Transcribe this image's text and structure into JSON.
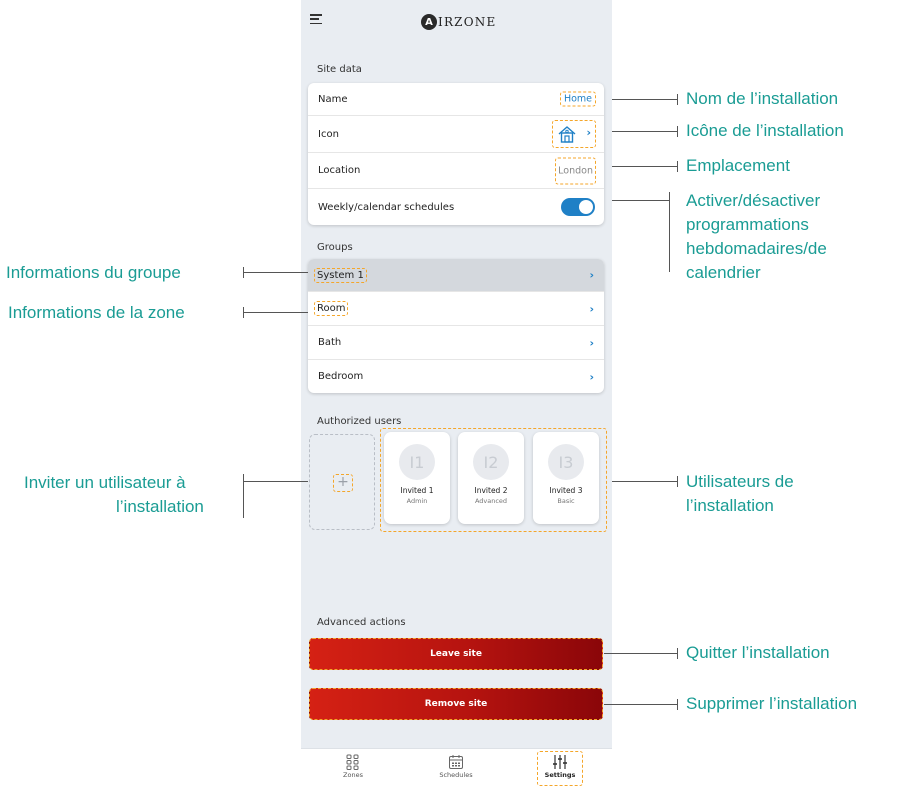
{
  "app": {
    "logo_mark": "A",
    "logo_text": "IRZONE"
  },
  "site_data": {
    "title": "Site data",
    "rows": [
      {
        "label": "Name",
        "value": "Home"
      },
      {
        "label": "Icon"
      },
      {
        "label": "Location",
        "value": "London"
      },
      {
        "label": "Weekly/calendar schedules",
        "toggle": true
      }
    ]
  },
  "groups": {
    "title": "Groups",
    "items": [
      "System 1",
      "Room",
      "Bath",
      "Bedroom"
    ]
  },
  "users": {
    "title": "Authorized users",
    "add_icon": "plus-icon",
    "list": [
      {
        "initials": "I1",
        "name": "Invited 1",
        "role": "Admin"
      },
      {
        "initials": "I2",
        "name": "Invited 2",
        "role": "Advanced"
      },
      {
        "initials": "I3",
        "name": "Invited 3",
        "role": "Basic"
      }
    ]
  },
  "advanced": {
    "title": "Advanced actions",
    "leave_label": "Leave site",
    "remove_label": "Remove site"
  },
  "bottom_nav": [
    "Zones",
    "Schedules",
    "Settings"
  ],
  "annotations": {
    "nom": "Nom de l’installation",
    "icone": "Icône de l’installation",
    "emplacement": "Emplacement",
    "activer": [
      "Activer/désactiver",
      "programmations",
      "hebdomadaires/de",
      "calendrier"
    ],
    "groupe": "Informations du groupe",
    "zone": "Informations de la zone",
    "inviter": [
      "Inviter un utilisateur à",
      "l’installation"
    ],
    "utilisateurs": [
      "Utilisateurs de",
      "l’installation"
    ],
    "quitter": "Quitter l’installation",
    "supprimer": "Supprimer l’installation"
  },
  "colors": {
    "accent": "#1f80c6",
    "highlight": "#f4a62a",
    "annotation": "#1a9c94",
    "danger": "#c0150f"
  }
}
